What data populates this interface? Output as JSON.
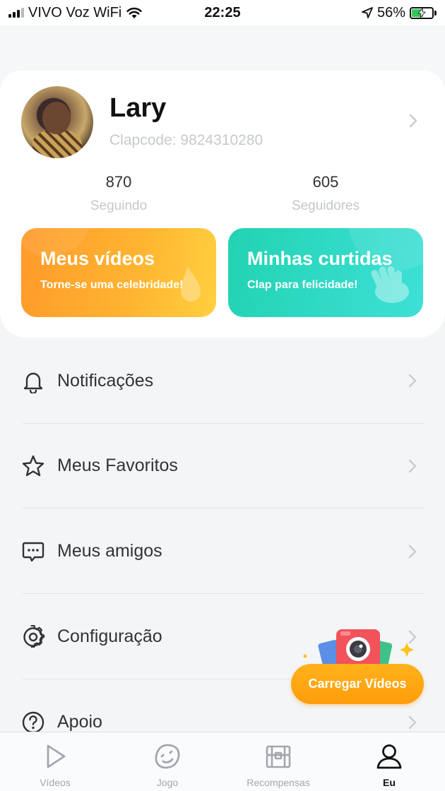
{
  "status_bar": {
    "carrier": "VIVO Voz WiFi",
    "time": "22:25",
    "battery_percent": "56%",
    "battery_level": 0.56
  },
  "profile": {
    "name": "Lary",
    "clapcode": "Clapcode: 9824310280",
    "following_count": "870",
    "following_label": "Seguindo",
    "followers_count": "605",
    "followers_label": "Seguidores"
  },
  "promos": {
    "my_videos": {
      "title": "Meus vídeos",
      "subtitle": "Torne-se uma celebridade!"
    },
    "my_likes": {
      "title": "Minhas curtidas",
      "subtitle": "Clap para felicidade!"
    }
  },
  "menu": {
    "items": [
      {
        "label": "Notificações",
        "icon": "bell-icon"
      },
      {
        "label": "Meus Favoritos",
        "icon": "star-icon"
      },
      {
        "label": "Meus amigos",
        "icon": "chat-icon"
      },
      {
        "label": "Configuração",
        "icon": "gear-icon"
      },
      {
        "label": "Apoio",
        "icon": "help-icon"
      }
    ]
  },
  "upload": {
    "label": "Carregar Vídeos"
  },
  "bottom_nav": {
    "items": [
      {
        "label": "Vídeos",
        "icon": "play-icon"
      },
      {
        "label": "Jogo",
        "icon": "game-icon"
      },
      {
        "label": "Recompensas",
        "icon": "treasure-chest-icon"
      },
      {
        "label": "Eu",
        "icon": "person-icon"
      }
    ],
    "active": "Eu"
  },
  "colors": {
    "orange_start": "#ff9a2a",
    "teal_start": "#22d3b2",
    "upload_orange": "#ffa514",
    "battery_green": "#34c759"
  }
}
